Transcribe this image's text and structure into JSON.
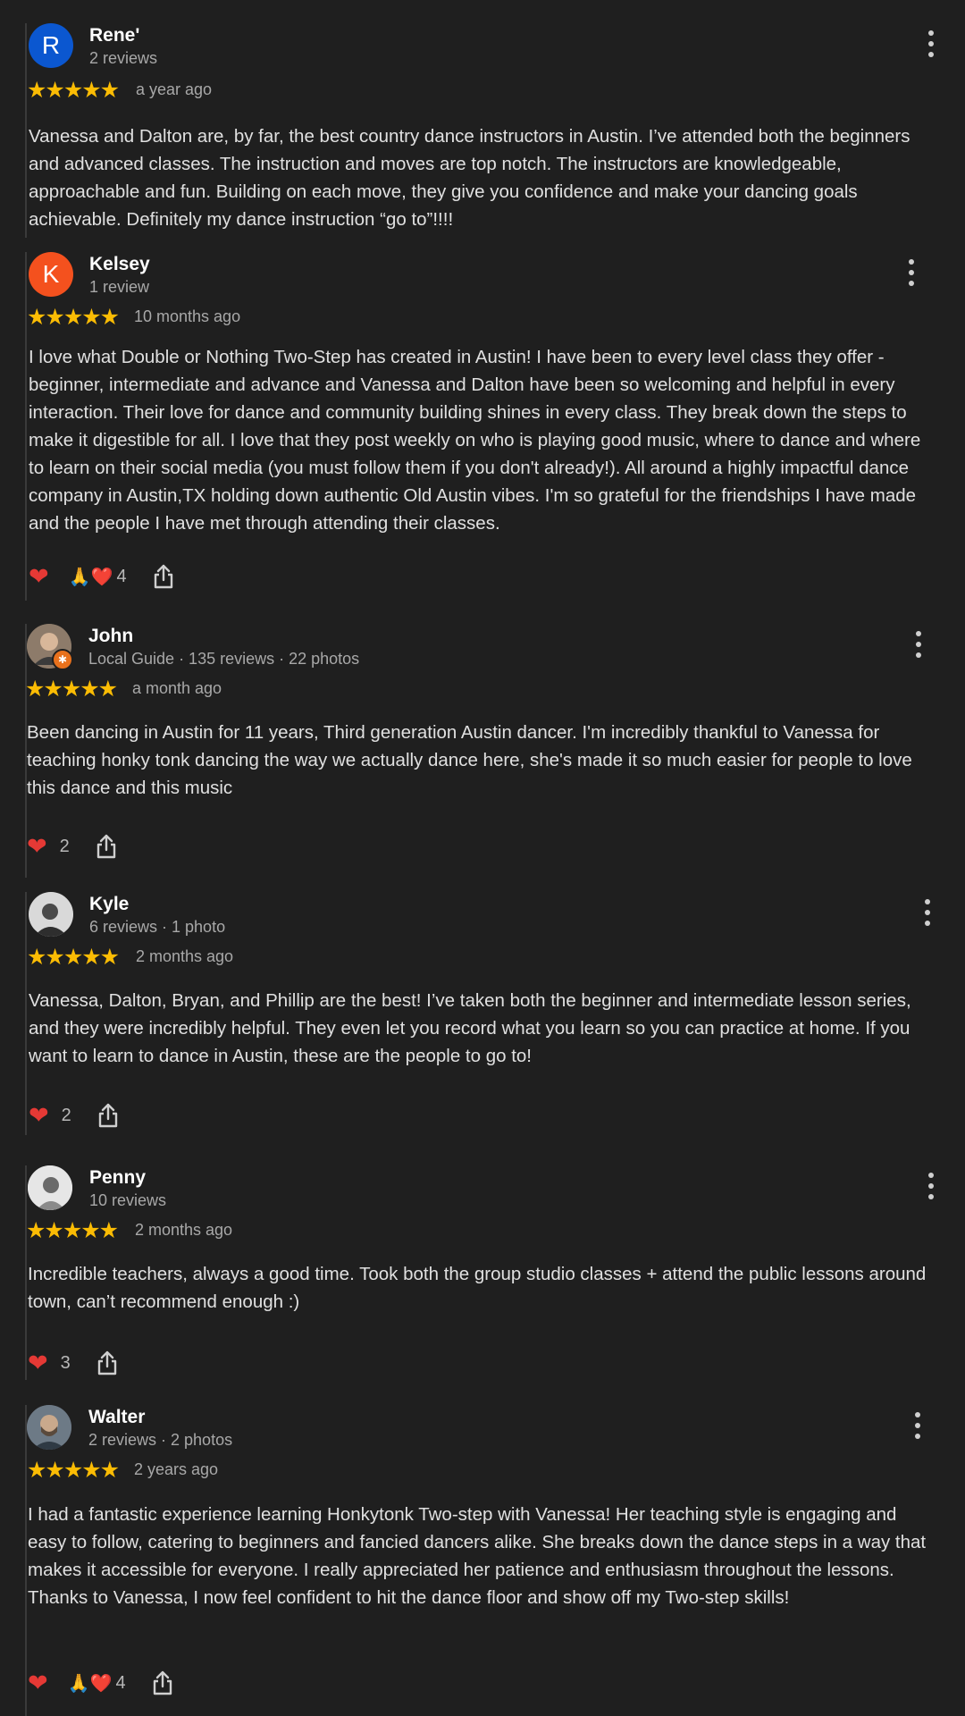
{
  "reviews": [
    {
      "name": "Rene'",
      "sub": "2 reviews",
      "avatar_letter": "R",
      "avatar_color": "#0b57d0",
      "stars": "★★★★★",
      "time": "a year ago",
      "text": "Vanessa and Dalton are, by far, the best country dance instructors in Austin. I’ve attended both the beginners and advanced classes. The instruction and moves are top notch. The instructors are knowledgeable, approachable and fun. Building on each move, they give you confidence and make your dancing goals achievable. Definitely my dance instruction “go to”!!!!"
    },
    {
      "name": "Kelsey",
      "sub": "1 review",
      "avatar_letter": "K",
      "avatar_color": "#f4511e",
      "stars": "★★★★★",
      "time": "10 months ago",
      "text": "I love what Double or Nothing Two-Step has created in Austin! I have been to every level class they offer - beginner, intermediate and advance and Vanessa and Dalton have been so welcoming and helpful in every interaction. Their love for dance and community building shines in every class. They break down the steps to make it digestible for all. I love that they post weekly on who is playing good music, where to dance and where to learn on their social media (you must follow them if you don't already!). All around a highly impactful dance company in Austin,TX holding down authentic Old Austin vibes. I'm so grateful for the friendships I have made and the people I have met through attending their classes.",
      "reaction_emoji": "🙏❤️",
      "reaction_count": "4"
    },
    {
      "name": "John",
      "sub": "Local Guide · 135 reviews · 22 photos",
      "stars": "★★★★★",
      "time": "a month ago",
      "text": "Been dancing in Austin for 11 years, Third generation Austin dancer. I'm incredibly thankful to Vanessa for teaching honky tonk dancing the way we actually dance here, she's made it so much easier for people to love this dance and this music",
      "reaction_count": "2"
    },
    {
      "name": "Kyle",
      "sub": "6 reviews · 1 photo",
      "stars": "★★★★★",
      "time": "2 months ago",
      "text": "Vanessa, Dalton, Bryan, and Phillip are the best! I’ve taken both the beginner and intermediate lesson series, and they were incredibly helpful. They even let you record what you learn so you can practice at home. If you want to learn to dance in Austin, these are the people to go to!",
      "reaction_count": "2"
    },
    {
      "name": "Penny",
      "sub": "10 reviews",
      "stars": "★★★★★",
      "time": "2 months ago",
      "text": "Incredible teachers, always a good time. Took both the group studio classes + attend the public lessons around town, can’t recommend enough :)",
      "reaction_count": "3"
    },
    {
      "name": "Walter",
      "sub": "2 reviews · 2 photos",
      "stars": "★★★★★",
      "time": "2 years ago",
      "text": "I had a fantastic experience learning Honkytonk Two-step with Vanessa! Her teaching style is engaging and easy to follow, catering to beginners and fancied dancers alike. She breaks down the dance steps in a way that makes it accessible for everyone. I really appreciated her patience and enthusiasm throughout the lessons. Thanks to Vanessa, I now feel confident to hit the dance floor and show off my Two-step skills!",
      "reaction_emoji": "🙏❤️",
      "reaction_count": "4"
    }
  ],
  "icons": {
    "heart": "❤",
    "more": "more-vert-icon",
    "share": "share-icon",
    "local_guide_badge": "✱"
  },
  "colors": {
    "background": "#1f1f1f",
    "star": "#fbbc04",
    "heart": "#e53935"
  }
}
